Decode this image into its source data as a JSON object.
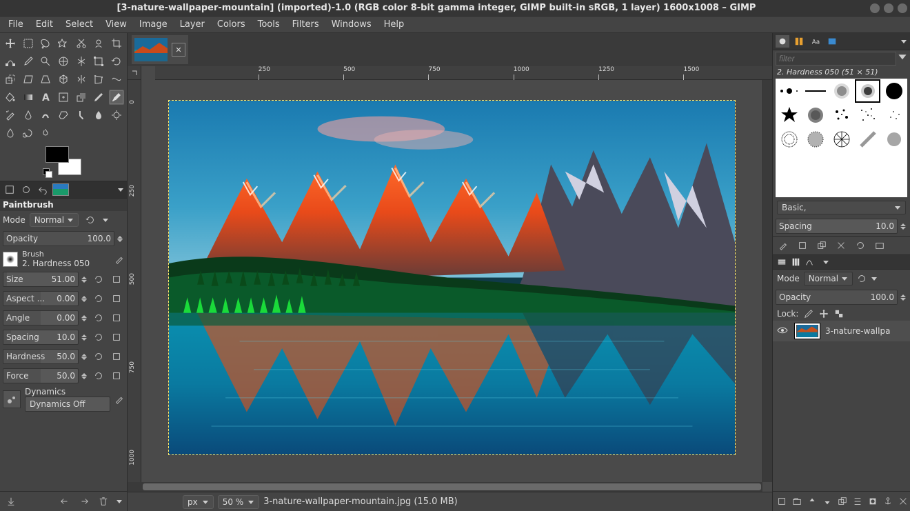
{
  "title": "[3-nature-wallpaper-mountain] (imported)-1.0 (RGB color 8-bit gamma integer, GIMP built-in sRGB, 1 layer) 1600x1008 – GIMP",
  "menubar": [
    "File",
    "Edit",
    "Select",
    "View",
    "Image",
    "Layer",
    "Colors",
    "Tools",
    "Filters",
    "Windows",
    "Help"
  ],
  "tool_options": {
    "title": "Paintbrush",
    "mode_label": "Mode",
    "mode_value": "Normal",
    "opacity_label": "Opacity",
    "opacity_value": "100.0",
    "brush_label": "Brush",
    "brush_name": "2. Hardness 050",
    "size_label": "Size",
    "size_value": "51.00",
    "aspect_label": "Aspect ...",
    "aspect_value": "0.00",
    "angle_label": "Angle",
    "angle_value": "0.00",
    "spacing_label": "Spacing",
    "spacing_value": "10.0",
    "hardness_label": "Hardness",
    "hardness_value": "50.0",
    "force_label": "Force",
    "force_value": "50.0",
    "dynamics_label": "Dynamics",
    "dynamics_value": "Dynamics Off"
  },
  "ruler_h": [
    "250",
    "500",
    "750",
    "1000",
    "1250",
    "1500"
  ],
  "ruler_v": [
    "0",
    "250",
    "500",
    "750",
    "1000"
  ],
  "status": {
    "unit": "px",
    "zoom": "50 %",
    "msg": "3-nature-wallpaper-mountain.jpg (15.0 MB)"
  },
  "right": {
    "filter_placeholder": "filter",
    "brush_title": "2. Hardness 050 (51 × 51)",
    "preset_label": "Basic,",
    "spacing_label": "Spacing",
    "spacing_value": "10.0",
    "layer_mode_label": "Mode",
    "layer_mode_value": "Normal",
    "layer_opacity_label": "Opacity",
    "layer_opacity_value": "100.0",
    "lock_label": "Lock:",
    "layer_name": "3-nature-wallpa"
  }
}
